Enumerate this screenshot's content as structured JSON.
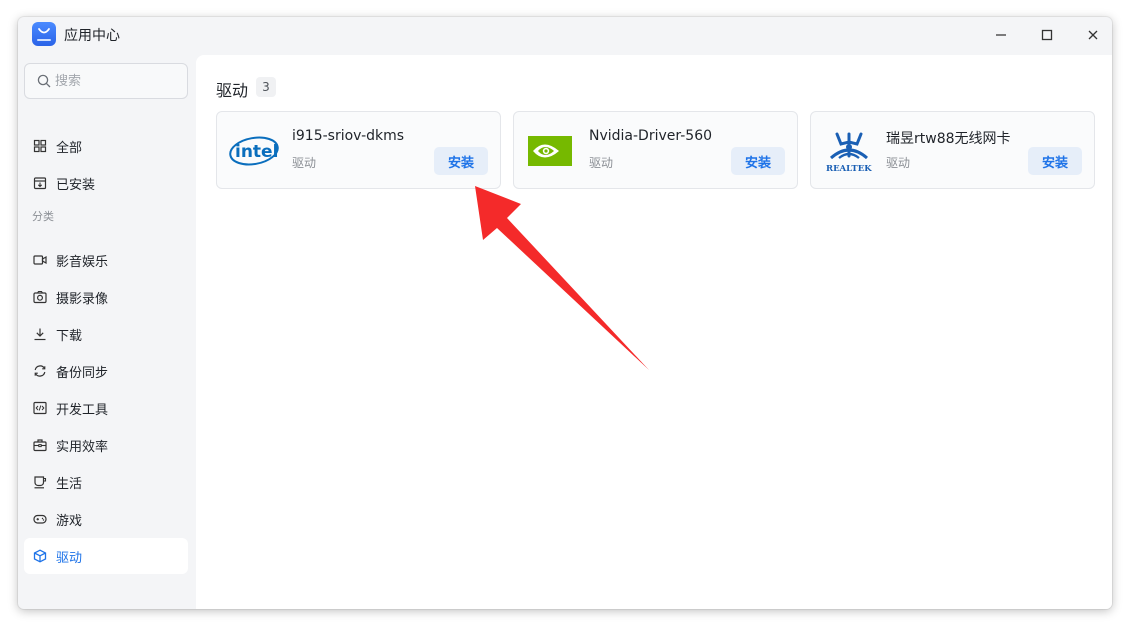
{
  "window": {
    "title": "应用中心",
    "icon": "app-store-icon"
  },
  "search": {
    "placeholder": "搜索"
  },
  "sidebar": {
    "top_items": [
      {
        "label": "全部",
        "icon": "grid-icon"
      },
      {
        "label": "已安装",
        "icon": "installed-box-icon"
      }
    ],
    "section_label": "分类",
    "categories": [
      {
        "label": "影音娱乐",
        "icon": "video-camera-icon"
      },
      {
        "label": "摄影录像",
        "icon": "camera-icon"
      },
      {
        "label": "下载",
        "icon": "download-icon"
      },
      {
        "label": "备份同步",
        "icon": "sync-icon"
      },
      {
        "label": "开发工具",
        "icon": "code-icon"
      },
      {
        "label": "实用效率",
        "icon": "toolbox-icon"
      },
      {
        "label": "生活",
        "icon": "cup-icon"
      },
      {
        "label": "游戏",
        "icon": "gamepad-icon"
      },
      {
        "label": "驱动",
        "icon": "cube-icon",
        "active": true
      }
    ]
  },
  "main": {
    "title": "驱动",
    "count": "3",
    "apps": [
      {
        "name": "i915-sriov-dkms",
        "category": "驱动",
        "button": "安装",
        "logo": "intel-logo-icon"
      },
      {
        "name": "Nvidia-Driver-560",
        "category": "驱动",
        "button": "安装",
        "logo": "nvidia-logo-icon"
      },
      {
        "name": "瑞昱rtw88无线网卡",
        "category": "驱动",
        "button": "安装",
        "logo": "realtek-logo-icon",
        "logo_text": "REALTEK"
      }
    ]
  },
  "colors": {
    "accent": "#1e73e8",
    "annotation_arrow": "#f42a2a"
  }
}
